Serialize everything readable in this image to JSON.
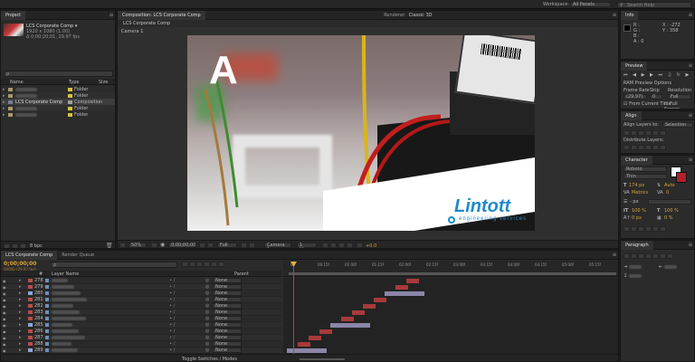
{
  "topbar": {
    "workspace_label": "Workspace:",
    "workspace_value": "All Panels",
    "search_placeholder": "Search Help"
  },
  "project": {
    "tab": "Project",
    "comp_name": "LCS Corporate Comp ▾",
    "comp_info_1": "1920 x 1080 (1.00)",
    "comp_info_2": "Δ 0;00;20;01, 29.97 fps",
    "search_placeholder": "ρ",
    "columns": {
      "name": "Name",
      "type": "Type",
      "size": "Size"
    },
    "items": [
      {
        "type": "Folder",
        "color": "#d8c23c",
        "selected": false
      },
      {
        "type": "Folder",
        "color": "#d8c23c",
        "selected": false
      },
      {
        "name": "LCS Corporate Comp",
        "type": "Composition",
        "color": "#a0a0a0",
        "selected": true
      },
      {
        "type": "Folder",
        "color": "#d8c23c",
        "selected": false
      },
      {
        "type": "Folder",
        "color": "#d8c23c",
        "selected": false
      }
    ],
    "footer_bpc": "8 bpc"
  },
  "composition": {
    "tab_label": "Composition: LCS Corporate Comp",
    "renderer_label": "Renderer:",
    "renderer_value": "Classic 3D",
    "subtab": "LCS Corporate Comp",
    "active_camera": "Camera 1",
    "letter": "A",
    "logo_text": "Lintott",
    "logo_sub": "engineering services",
    "footer": {
      "zoom": "50%",
      "timecode": "0;00;00;00",
      "resolution": "Full",
      "camera": "Camera 1",
      "views": "1 View",
      "exposure": "+0.0"
    }
  },
  "info": {
    "tab": "Info",
    "x_label": "X : -272",
    "y_label": "Y : 358",
    "r": "R :",
    "g": "G :",
    "b": "B :",
    "a": "A : 0"
  },
  "preview": {
    "tab": "Preview",
    "options": "RAM Preview Options",
    "frame_rate_label": "Frame Rate",
    "skip_label": "Skip",
    "resolution_label": "Resolution",
    "frame_rate_value": "(29.97)",
    "skip_value": "0",
    "resolution_value": "Full",
    "from_current": "From Current Time",
    "full_screen": "Full Screen"
  },
  "align": {
    "tab": "Align",
    "align_to": "Align Layers to:",
    "align_to_value": "Selection",
    "distribute": "Distribute Layers:"
  },
  "character": {
    "tab": "Character",
    "font": "Roboto",
    "style": "Thin",
    "size": "174 px",
    "leading": "Auto",
    "kerning": "Metrics",
    "tracking": "0",
    "stroke_width": "- px",
    "vscale": "100 %",
    "hscale": "100 %",
    "baseline": "0 px",
    "tsume": "0 %"
  },
  "paragraph": {
    "tab": "Paragraph"
  },
  "timeline": {
    "tabs": [
      "LCS Corporate Comp",
      "Render Queue"
    ],
    "timecode": "0;00;00;00",
    "frames": "00000 (29.97 fps)",
    "search_placeholder": "ρ",
    "header_num": "#",
    "header_layer": "Layer Name",
    "header_parent": "Parent",
    "footer": "Toggle Switches / Modes",
    "ruler": [
      "0f",
      "00:15f",
      "01:00f",
      "01:15f",
      "02:00f",
      "02:15f",
      "03:00f",
      "03:15f",
      "04:00f",
      "04:15f",
      "05:00f",
      "05:15f"
    ],
    "layers": [
      {
        "num": "278",
        "color": "#b84b4b",
        "parent": "None"
      },
      {
        "num": "279",
        "color": "#b84b4b",
        "parent": "None"
      },
      {
        "num": "280",
        "color": "#8aa5d6",
        "parent": "None"
      },
      {
        "num": "281",
        "color": "#b84b4b",
        "parent": "None"
      },
      {
        "num": "282",
        "color": "#b84b4b",
        "parent": "None"
      },
      {
        "num": "283",
        "color": "#b84b4b",
        "parent": "None"
      },
      {
        "num": "284",
        "color": "#b84b4b",
        "parent": "None"
      },
      {
        "num": "285",
        "color": "#8aa5d6",
        "parent": "None"
      },
      {
        "num": "286",
        "color": "#b84b4b",
        "parent": "None"
      },
      {
        "num": "287",
        "color": "#b84b4b",
        "parent": "None"
      },
      {
        "num": "288",
        "color": "#b84b4b",
        "parent": "None"
      },
      {
        "num": "289",
        "color": "#8aa5d6",
        "parent": "None"
      }
    ]
  }
}
